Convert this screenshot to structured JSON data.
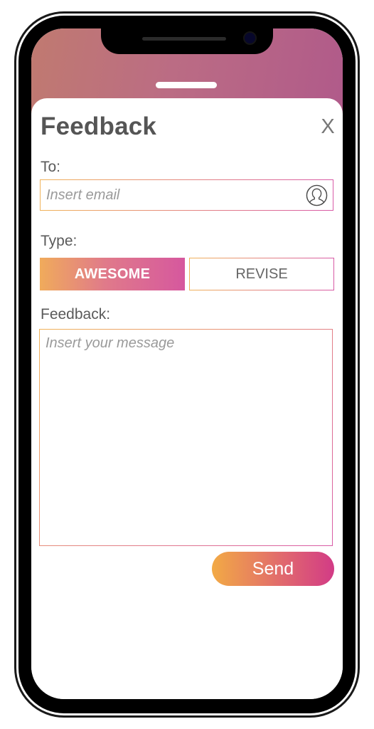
{
  "feedback": {
    "title": "Feedback",
    "close_label": "X"
  },
  "to": {
    "label": "To:",
    "placeholder": "Insert email",
    "value": ""
  },
  "type": {
    "label": "Type:",
    "options": [
      "AWESOME",
      "REVISE"
    ],
    "selected": "AWESOME"
  },
  "message": {
    "label": "Feedback:",
    "placeholder": "Insert your message",
    "value": ""
  },
  "send": {
    "label": "Send"
  },
  "icons": {
    "close": "close-icon",
    "contact": "user-circle-icon"
  },
  "colors": {
    "gradient_start": "#f0ab5b",
    "gradient_end": "#d6589e",
    "header_gradient": "#b96a84",
    "title_text": "#555555"
  }
}
